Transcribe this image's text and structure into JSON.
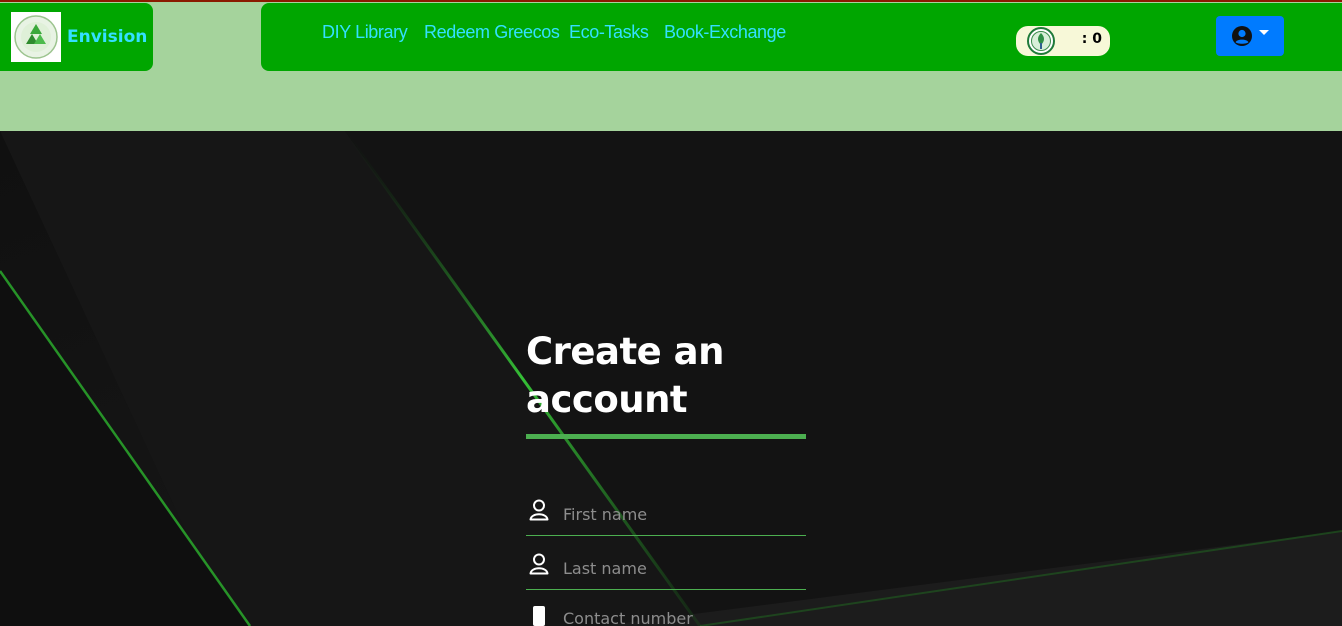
{
  "brand": {
    "name": "Envision"
  },
  "nav": {
    "links": [
      {
        "label": "DIY Library"
      },
      {
        "label": "Redeem Greecos"
      },
      {
        "label": "Eco-Tasks"
      },
      {
        "label": "Book-Exchange"
      }
    ],
    "coins": {
      "display": ": 0"
    }
  },
  "form": {
    "title": "Create an account",
    "fields": [
      {
        "placeholder": "First name",
        "icon": "user-icon"
      },
      {
        "placeholder": "Last name",
        "icon": "user-icon"
      },
      {
        "placeholder": "Contact number",
        "icon": "phone-icon"
      }
    ]
  },
  "colors": {
    "nav_green": "#00a600",
    "header_light_green": "#a5d39c",
    "link_cyan": "#33e0ff",
    "user_button_blue": "#007bff",
    "accent_green": "#4caf50"
  }
}
